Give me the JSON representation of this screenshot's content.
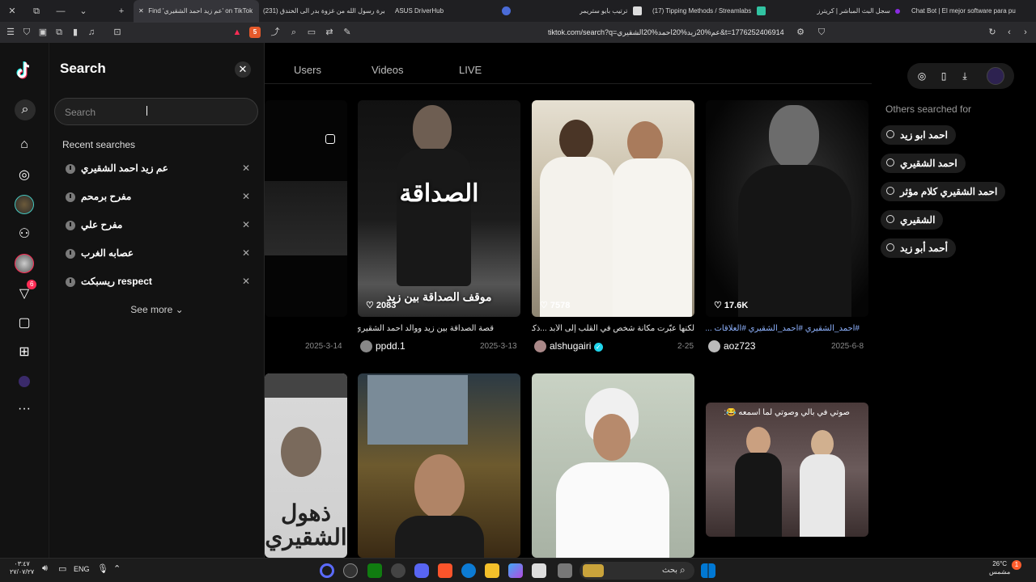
{
  "browser": {
    "tabs": [
      {
        "title": "Find 'عم زيد احمد الشقيري' on TikTok",
        "active": true
      },
      {
        "title": "(231) سيرة رسول الله من غزوة بدر الى الخندق"
      },
      {
        "title": "ASUS DriverHub"
      },
      {
        "title": ""
      },
      {
        "title": "ترتيب بايو ستريمر"
      },
      {
        "title": "(17) Tipping Methods / Streamlabs"
      },
      {
        "title": "سجل البث المباشر | كريترز"
      },
      {
        "title": "Chat Bot | El mejor software para pu"
      }
    ],
    "url": "tiktok.com/search?q=عم%20زيد%20احمد%20الشقيري&t=1776252406914",
    "shield_count": "5"
  },
  "rail": {
    "inbox_badge": "6"
  },
  "search_panel": {
    "title": "Search",
    "placeholder": "Search",
    "recent_title": "Recent searches",
    "recent": [
      "عم زيد احمد الشقيري",
      "مفرح برمحم",
      "مفرح علي",
      "عصابه الغرب",
      "ريسبكت respect"
    ],
    "see_more": "See more"
  },
  "main": {
    "tabs": [
      "Users",
      "Videos",
      "LIVE"
    ],
    "videos_row1": [
      {
        "desc": "",
        "author": "",
        "date": "2025-3-14",
        "overlay": ""
      },
      {
        "likes": "2083",
        "desc": "قصة الصداقة بين زيد ووالد احمد الشقيري...",
        "author": "ppdd.1",
        "date": "2025-3-13",
        "overlay": "الصداقة",
        "caption": "موقف الصداقة بين زيد"
      },
      {
        "likes": "7578",
        "desc": "لكنها عبّرت مكانة شخص في القلب إلى الأبد ...ذكر",
        "author": "alshugairi",
        "date": "2-25",
        "verified": true
      },
      {
        "likes": "17.6K",
        "desc": "#احمد_الشقيري #أحمد_الشقيري #العلاقات ...",
        "author": "aoz723",
        "date": "2025-6-8"
      }
    ],
    "videos_row2": [
      {
        "overlay": "ذهول الشقيري"
      },
      {},
      {},
      {
        "caption": "صوتي في بالي وصوتي لما اسمعه 😂:"
      }
    ]
  },
  "right_panel": {
    "others_title": "Others searched for",
    "suggestions": [
      "احمد ابو زيد",
      "احمد الشقيري",
      "احمد الشقيري كلام مؤثر",
      "الشقيري",
      "أحمد أبو زيد"
    ]
  },
  "taskbar": {
    "time": "٠٣:٤٧",
    "date": "٢٧/٠٧/٢٧",
    "lang": "ENG",
    "search_label": "بحث",
    "temp": "26°C",
    "weather": "مشمس",
    "notif_count": "1"
  },
  "colors": {
    "accent": "#fe2c55",
    "teal": "#25f4ee"
  }
}
